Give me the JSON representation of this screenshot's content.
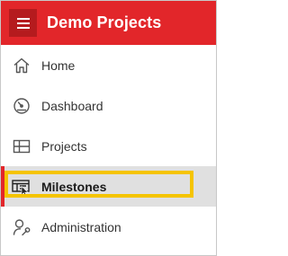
{
  "header": {
    "title": "Demo Projects",
    "menu_icon": "hamburger-icon",
    "background_color": "#e2262a",
    "menu_button_color": "#b51b1e"
  },
  "nav": {
    "active_color": "#e2262a",
    "highlight_color": "#f5c400",
    "items": [
      {
        "label": "Home",
        "icon": "home-icon"
      },
      {
        "label": "Dashboard",
        "icon": "gauge-icon"
      },
      {
        "label": "Projects",
        "icon": "grid-icon"
      },
      {
        "label": "Milestones",
        "icon": "milestones-icon",
        "active": true
      },
      {
        "label": "Administration",
        "icon": "user-wrench-icon"
      }
    ]
  }
}
